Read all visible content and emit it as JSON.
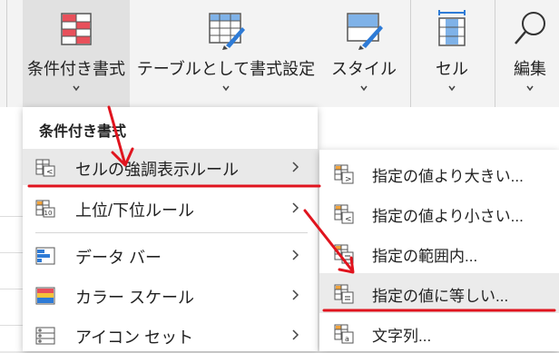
{
  "ribbon": {
    "conditional_format_label": "条件付き書式",
    "format_as_table_label": "テーブルとして書式設定",
    "styles_label": "スタイル",
    "cells_label": "セル",
    "editing_label": "編集"
  },
  "menu": {
    "title": "条件付き書式",
    "items": [
      {
        "label": "セルの強調表示ルール"
      },
      {
        "label": "上位/下位ルール"
      },
      {
        "label": "データ バー"
      },
      {
        "label": "カラー スケール"
      },
      {
        "label": "アイコン セット"
      }
    ]
  },
  "submenu": {
    "items": [
      {
        "label": "指定の値より大きい..."
      },
      {
        "label": "指定の値より小さい..."
      },
      {
        "label": "指定の範囲内..."
      },
      {
        "label": "指定の値に等しい..."
      },
      {
        "label": "文字列..."
      }
    ]
  },
  "colors": {
    "annotation_red": "#e0141e",
    "accent_blue": "#2e7bd6"
  }
}
